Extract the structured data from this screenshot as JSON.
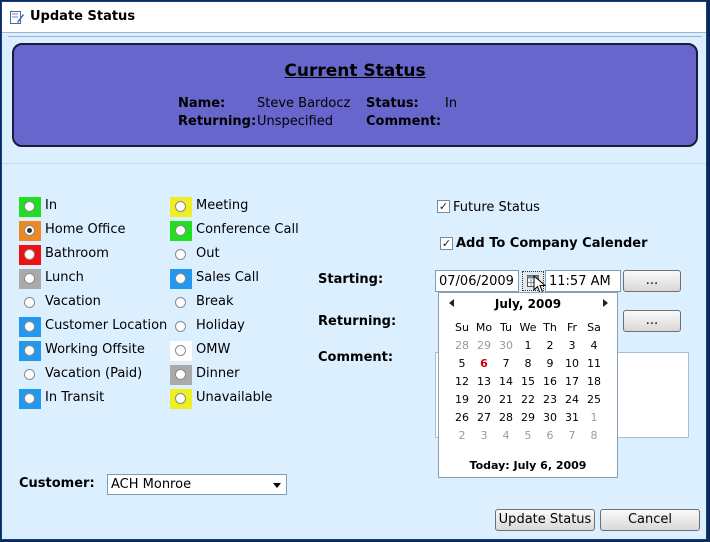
{
  "window": {
    "title": "Update Status"
  },
  "current_status": {
    "heading": "Current Status",
    "name_label": "Name:",
    "name_value": "Steve Bardocz",
    "status_label": "Status:",
    "status_value": "In",
    "returning_label": "Returning:",
    "returning_value": "Unspecified",
    "comment_label": "Comment:",
    "comment_value": ""
  },
  "status_options_left": [
    {
      "label": "In",
      "color": "#22dd22",
      "selected": false
    },
    {
      "label": "Home Office",
      "color": "#ee8822",
      "selected": true
    },
    {
      "label": "Bathroom",
      "color": "#ee1111",
      "selected": false
    },
    {
      "label": "Lunch",
      "color": "#aaaaaa",
      "selected": false
    },
    {
      "label": "Vacation",
      "color": "",
      "selected": false
    },
    {
      "label": "Customer Location",
      "color": "#2299ee",
      "selected": false
    },
    {
      "label": "Working Offsite",
      "color": "#2299ee",
      "selected": false
    },
    {
      "label": "Vacation (Paid)",
      "color": "",
      "selected": false
    },
    {
      "label": "In Transit",
      "color": "#2299ee",
      "selected": false
    }
  ],
  "status_options_right": [
    {
      "label": "Meeting",
      "color": "#eeee22",
      "selected": false
    },
    {
      "label": "Conference Call",
      "color": "#22dd22",
      "selected": false
    },
    {
      "label": "Out",
      "color": "",
      "selected": false
    },
    {
      "label": "Sales Call",
      "color": "#2299ee",
      "selected": false
    },
    {
      "label": "Break",
      "color": "",
      "selected": false
    },
    {
      "label": "Holiday",
      "color": "",
      "selected": false
    },
    {
      "label": "OMW",
      "color": "#ffffff",
      "selected": false
    },
    {
      "label": "Dinner",
      "color": "#aaaaaa",
      "selected": false
    },
    {
      "label": "Unavailable",
      "color": "#eeee22",
      "selected": false
    }
  ],
  "future_status": {
    "label": "Future Status",
    "checked": true
  },
  "add_to_calendar": {
    "label": "Add To Company Calender",
    "checked": true
  },
  "starting": {
    "label": "Starting:",
    "date": "07/06/2009",
    "time": "11:57 AM",
    "more": "..."
  },
  "returning": {
    "label": "Returning:",
    "more": "..."
  },
  "comment": {
    "label": "Comment:",
    "value": ""
  },
  "calendar": {
    "month": "July, 2009",
    "days_of_week": [
      "Su",
      "Mo",
      "Tu",
      "We",
      "Th",
      "Fr",
      "Sa"
    ],
    "weeks": [
      [
        "28",
        "29",
        "30",
        "1",
        "2",
        "3",
        "4"
      ],
      [
        "5",
        "6",
        "7",
        "8",
        "9",
        "10",
        "11"
      ],
      [
        "12",
        "13",
        "14",
        "15",
        "16",
        "17",
        "18"
      ],
      [
        "19",
        "20",
        "21",
        "22",
        "23",
        "24",
        "25"
      ],
      [
        "26",
        "27",
        "28",
        "29",
        "30",
        "31",
        "1"
      ],
      [
        "2",
        "3",
        "4",
        "5",
        "6",
        "7",
        "8"
      ]
    ],
    "today_label": "Today: July 6, 2009",
    "highlight": "6"
  },
  "customer": {
    "label": "Customer:",
    "value": "ACH Monroe"
  },
  "buttons": {
    "update": "Update Status",
    "cancel": "Cancel"
  },
  "colors": {
    "status_panel": "#6666cc",
    "background": "#dcefff"
  }
}
